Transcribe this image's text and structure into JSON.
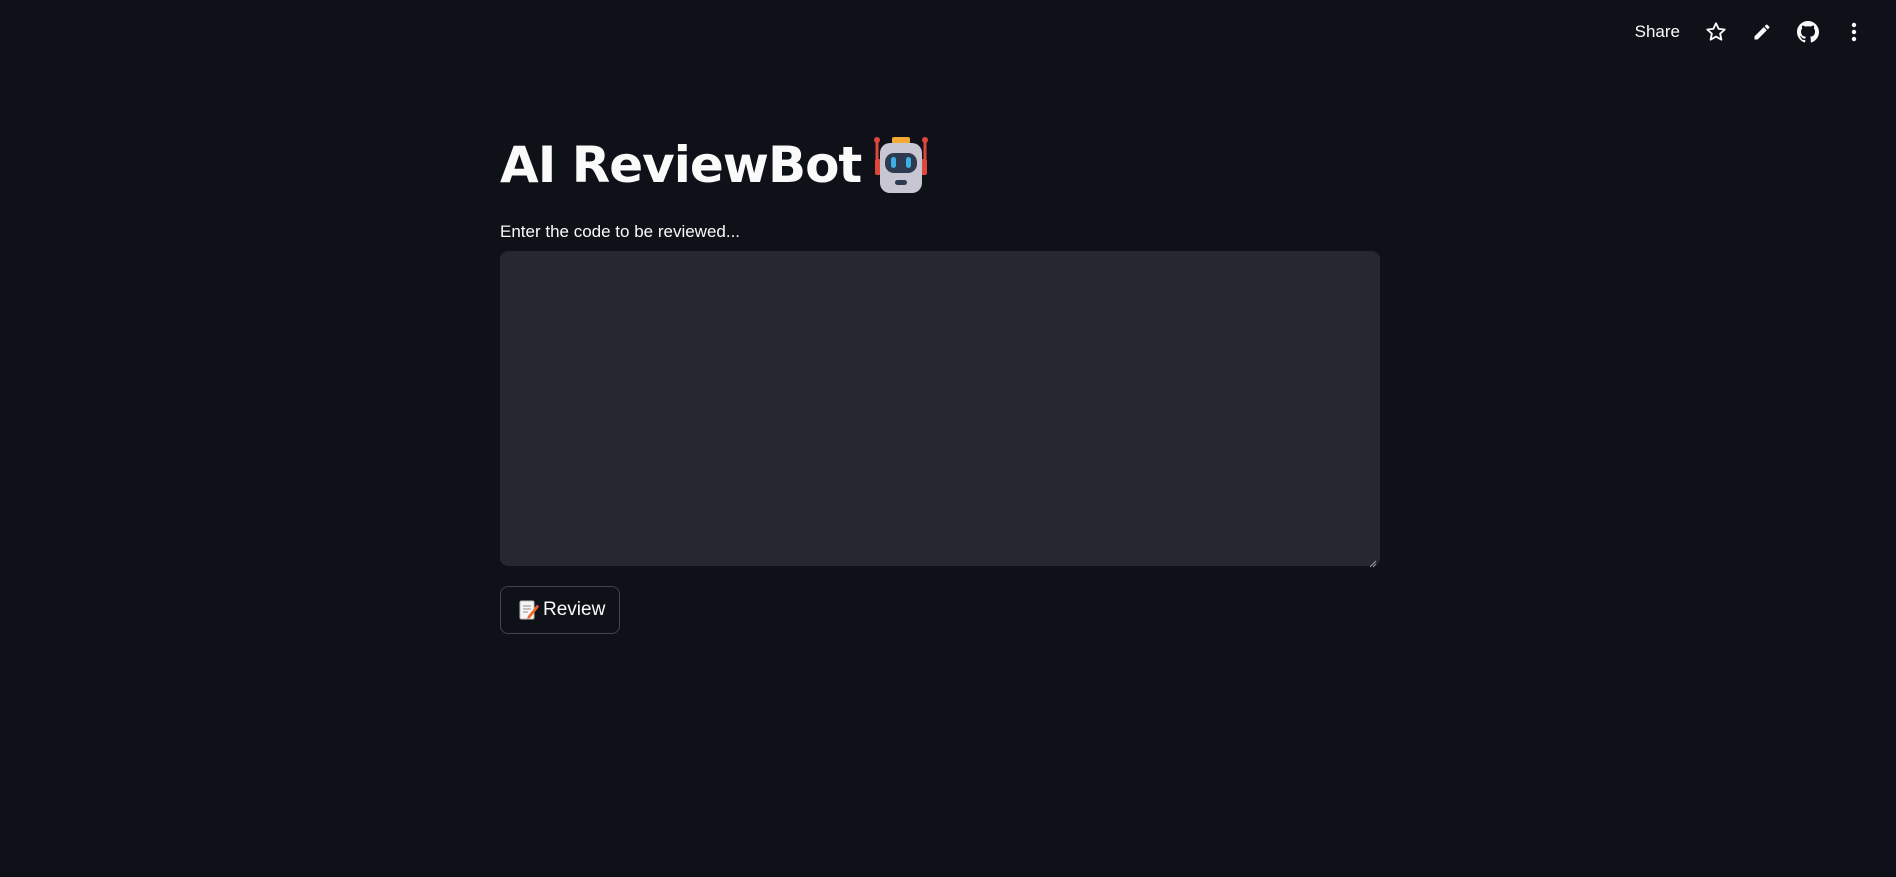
{
  "toolbar": {
    "share_label": "Share",
    "icons": [
      "star-icon",
      "pencil-icon",
      "github-icon",
      "more-vertical-icon"
    ]
  },
  "main": {
    "title": "AI ReviewBot",
    "title_icon": "robot-emoji",
    "input_label": "Enter the code to be reviewed...",
    "input_value": "",
    "review_button_label": "Review",
    "review_button_icon": "memo-emoji"
  },
  "colors": {
    "background": "#0e1117",
    "text": "#fafafa",
    "input_background": "#262730"
  }
}
